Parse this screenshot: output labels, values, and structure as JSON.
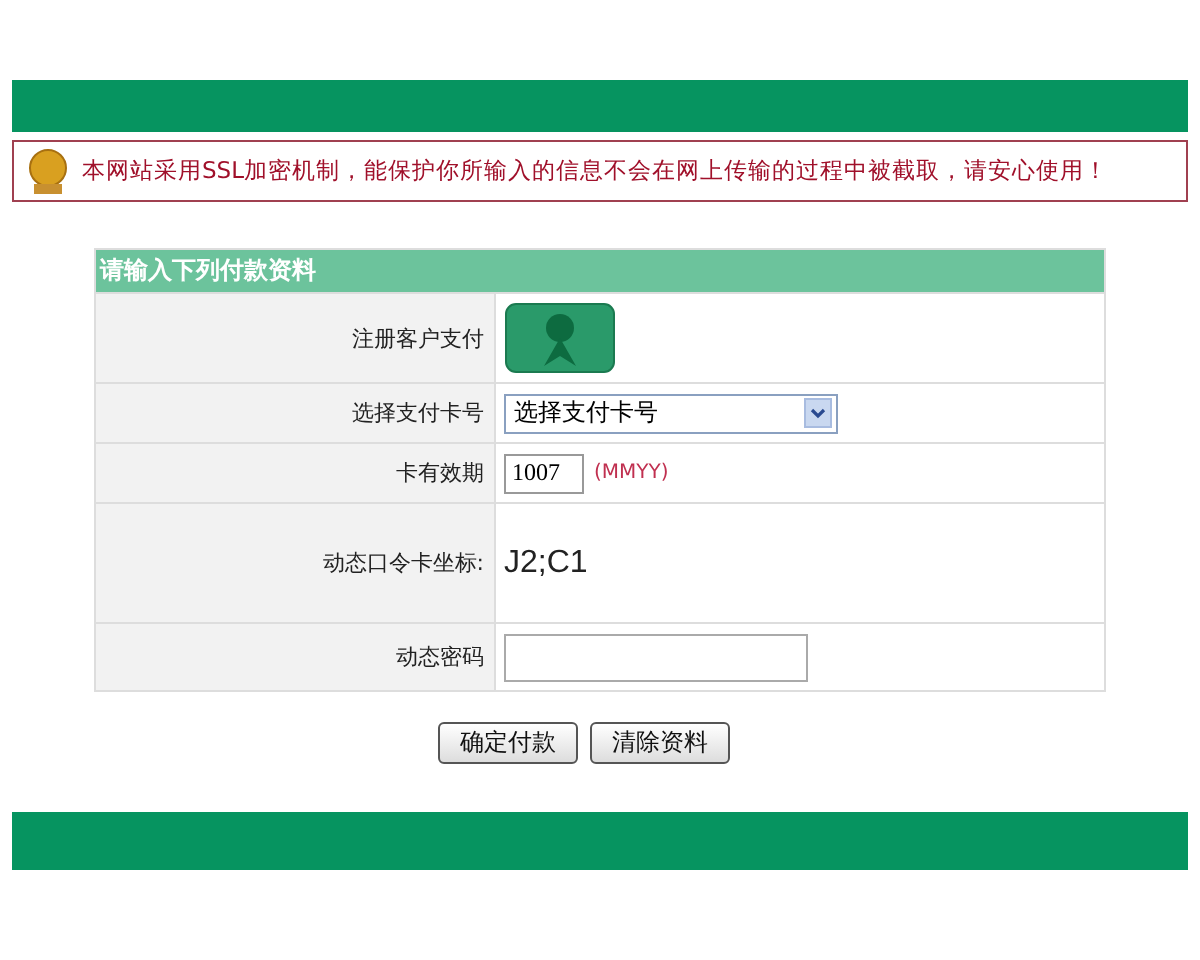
{
  "notice": {
    "text": "本网站采用SSL加密机制，能保护你所输入的信息不会在网上传输的过程中被截取，请安心使用！"
  },
  "form": {
    "title": "请输入下列付款资料",
    "rows": [
      {
        "kind": "badge",
        "label": "注册客户支付"
      },
      {
        "kind": "select",
        "label": "选择支付卡号",
        "value": "选择支付卡号"
      },
      {
        "kind": "expiry",
        "label": "卡有效期",
        "value": "1007",
        "hint": "(MMYY)"
      },
      {
        "kind": "text",
        "label": "动态口令卡坐标:",
        "value": "J2;C1"
      },
      {
        "kind": "input",
        "label": "动态密码"
      }
    ]
  },
  "buttons": [
    "确定付款",
    "清除资料"
  ]
}
